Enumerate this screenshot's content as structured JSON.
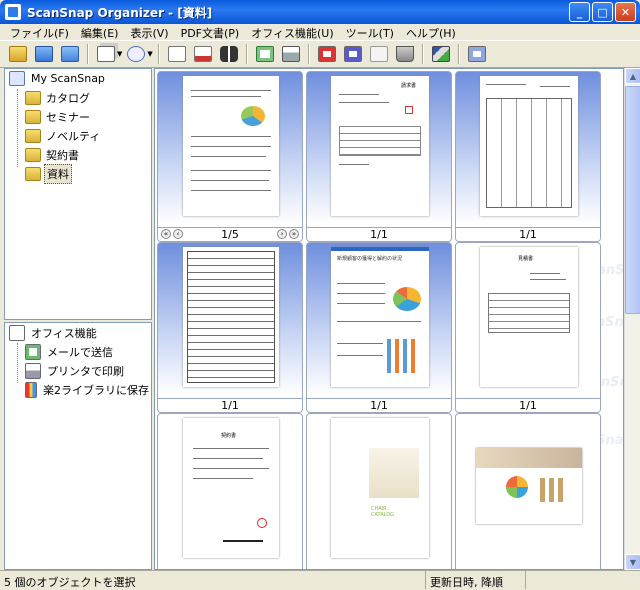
{
  "window": {
    "title": "ScanSnap Organizer - [資料]"
  },
  "menu": [
    "ファイル(F)",
    "編集(E)",
    "表示(V)",
    "PDF文書(P)",
    "オフィス機能(U)",
    "ツール(T)",
    "ヘルプ(H)"
  ],
  "tree": {
    "root": "My ScanSnap",
    "folders": [
      "カタログ",
      "セミナー",
      "ノベルティ",
      "契約書",
      "資料"
    ],
    "selected": "資料"
  },
  "office": {
    "title": "オフィス機能",
    "items": [
      "メールで送信",
      "プリンタで印刷",
      "楽2ライブラリに保存"
    ]
  },
  "thumbnails": [
    {
      "page": "1/5",
      "selected": true
    },
    {
      "page": "1/1",
      "selected": true
    },
    {
      "page": "1/1",
      "selected": true
    },
    {
      "page": "1/1",
      "selected": true
    },
    {
      "page": "1/1",
      "selected": true
    },
    {
      "page": "1/1",
      "selected": false
    },
    {
      "page": "",
      "selected": false
    },
    {
      "page": "",
      "selected": false
    },
    {
      "page": "",
      "selected": false
    }
  ],
  "doc_text": {
    "invoice_title": "請求書",
    "report_title": "新規顧客の獲得と解約の状況",
    "estimate_title": "見積書",
    "contract_title": "契約書",
    "catalog_title": "CHAIR CATALOG"
  },
  "watermark": "ScanSnap",
  "status": {
    "left": "5 個のオブジェクトを選択",
    "right": "更新日時, 降順"
  },
  "icons": [
    "new-folder-icon",
    "open-folder-icon",
    "folder-icon",
    "view-icon",
    "rotate-icon",
    "ocr-icon",
    "pdf-icon",
    "binoculars-icon",
    "mail-icon",
    "print-icon",
    "convert-word-icon",
    "convert-excel-icon",
    "convert-pdf-icon",
    "trash-icon",
    "tools-icon",
    "magnifier-icon"
  ]
}
